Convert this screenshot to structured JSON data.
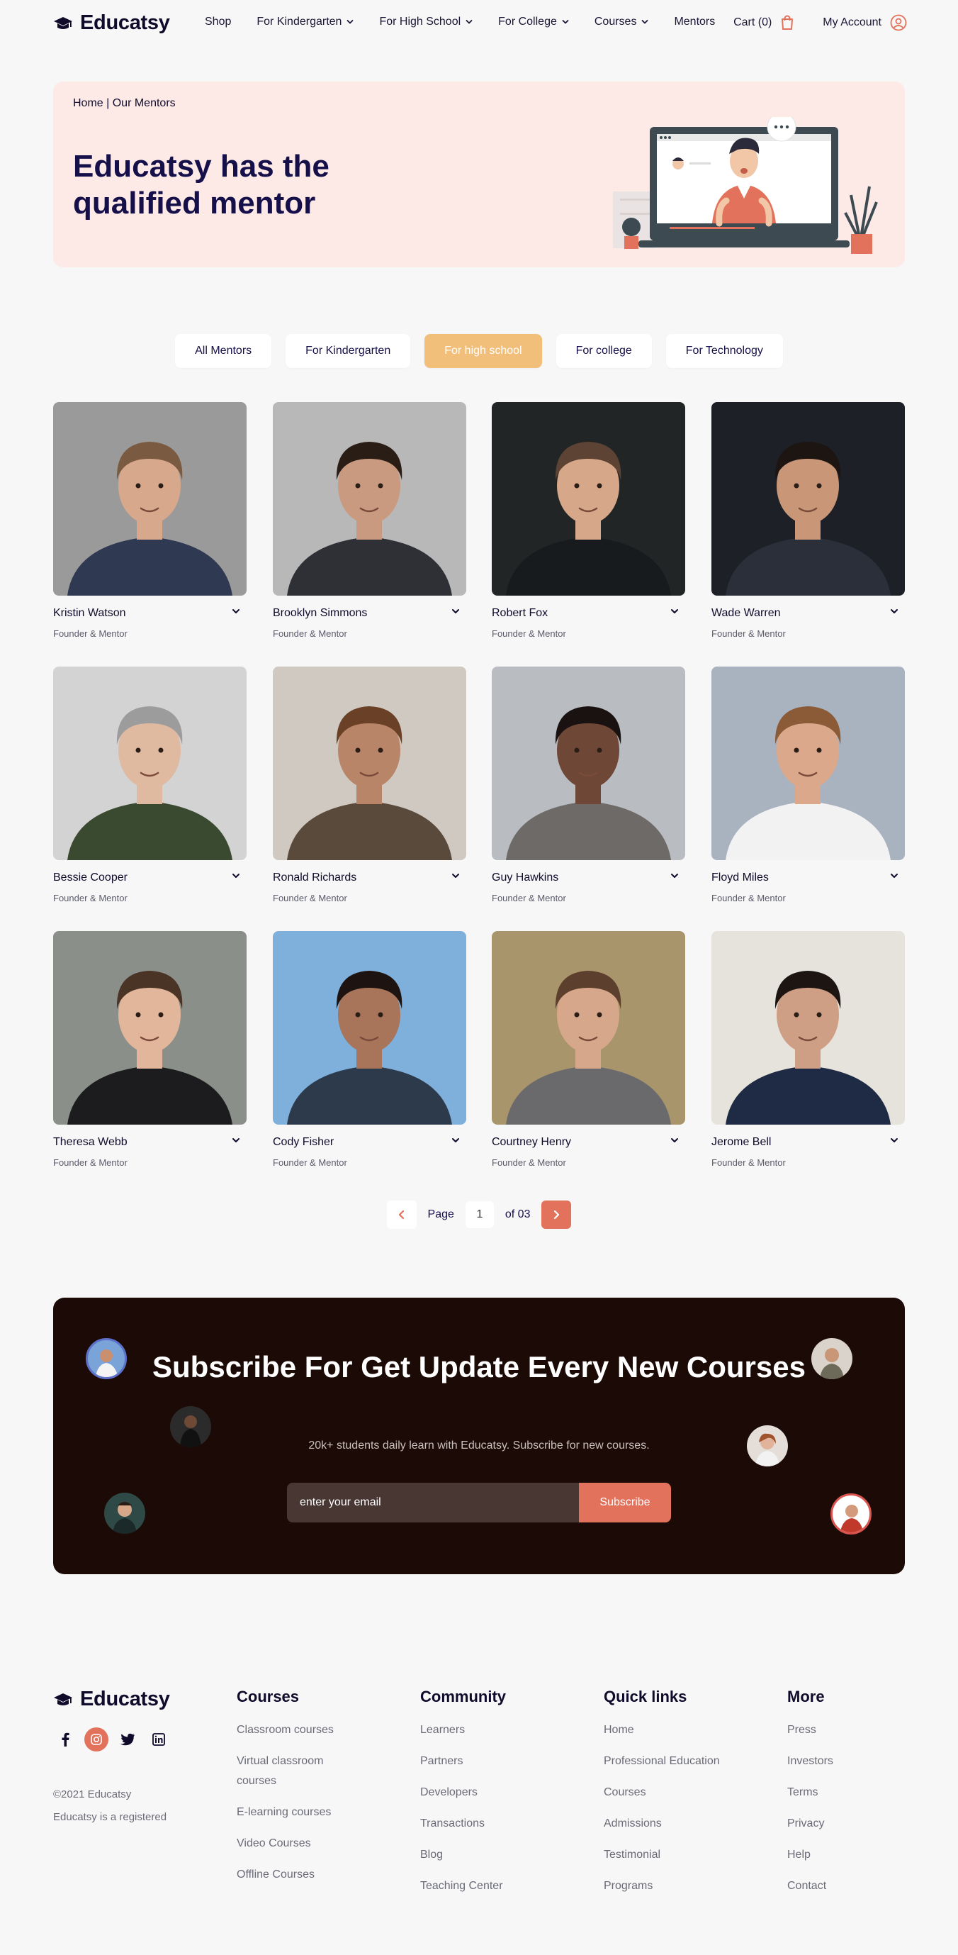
{
  "brand": {
    "name": "Educatsy"
  },
  "nav": {
    "items": [
      {
        "label": "Shop",
        "dropdown": false
      },
      {
        "label": "For Kindergarten",
        "dropdown": true
      },
      {
        "label": "For High School",
        "dropdown": true
      },
      {
        "label": "For College",
        "dropdown": true
      },
      {
        "label": "Courses",
        "dropdown": true
      },
      {
        "label": "Mentors",
        "dropdown": false
      }
    ],
    "cart_label": "Cart (0)",
    "account_label": "My Account"
  },
  "hero": {
    "breadcrumb": "Home | Our Mentors",
    "title": "Educatsy has the qualified mentor"
  },
  "filters": [
    {
      "label": "All Mentors",
      "active": false
    },
    {
      "label": "For Kindergarten",
      "active": false
    },
    {
      "label": "For high school",
      "active": true
    },
    {
      "label": "For college",
      "active": false
    },
    {
      "label": "For Technology",
      "active": false
    }
  ],
  "mentors": [
    {
      "name": "Kristin Watson",
      "role": "Founder & Mentor",
      "bg": "#9a9a9a",
      "shirt": "#2f3a52",
      "skin": "#d7a88c",
      "hair": "#7a5a40"
    },
    {
      "name": "Brooklyn Simmons",
      "role": "Founder & Mentor",
      "bg": "#b8b8b8",
      "shirt": "#2f3036",
      "skin": "#c99a80",
      "hair": "#2a1d16"
    },
    {
      "name": "Robert Fox",
      "role": "Founder & Mentor",
      "bg": "#222526",
      "shirt": "#181b1d",
      "skin": "#d6a889",
      "hair": "#5d4333"
    },
    {
      "name": "Wade Warren",
      "role": "Founder & Mentor",
      "bg": "#1d2027",
      "shirt": "#2b2f3a",
      "skin": "#c99778",
      "hair": "#1d1511"
    },
    {
      "name": "Bessie Cooper",
      "role": "Founder & Mentor",
      "bg": "#d3d3d3",
      "shirt": "#3a4a31",
      "skin": "#e0b9a1",
      "hair": "#9c9c9c"
    },
    {
      "name": "Ronald Richards",
      "role": "Founder & Mentor",
      "bg": "#cfc9c2",
      "shirt": "#5a4a3c",
      "skin": "#b98569",
      "hair": "#6a4126"
    },
    {
      "name": "Guy Hawkins",
      "role": "Founder & Mentor",
      "bg": "#b9bcc0",
      "shirt": "#6d6a68",
      "skin": "#6e4736",
      "hair": "#1a1210"
    },
    {
      "name": "Floyd Miles",
      "role": "Founder & Mentor",
      "bg": "#a8b3bf",
      "shirt": "#f2f2f2",
      "skin": "#dba88c",
      "hair": "#8b5a36"
    },
    {
      "name": "Theresa Webb",
      "role": "Founder & Mentor",
      "bg": "#8a8f8a",
      "shirt": "#1c1c1e",
      "skin": "#e2b69b",
      "hair": "#4a3426"
    },
    {
      "name": "Cody Fisher",
      "role": "Founder & Mentor",
      "bg": "#7fb0dc",
      "shirt": "#2c3a4c",
      "skin": "#a8755a",
      "hair": "#1d1411"
    },
    {
      "name": "Courtney Henry",
      "role": "Founder & Mentor",
      "bg": "#a9956c",
      "shirt": "#6a6a6c",
      "skin": "#d6a78a",
      "hair": "#5c3f2c"
    },
    {
      "name": "Jerome Bell",
      "role": "Founder & Mentor",
      "bg": "#e6e3dc",
      "shirt": "#1f2b44",
      "skin": "#cf9f85",
      "hair": "#1c1512"
    }
  ],
  "pagination": {
    "page_label": "Page",
    "current": "1",
    "of_label": "of 03"
  },
  "subscribe": {
    "title": "Subscribe For Get Update Every New Courses",
    "desc": "20k+ students daily learn with Educatsy. Subscribe for new courses.",
    "placeholder": "enter your email",
    "button": "Subscribe"
  },
  "footer": {
    "copyright": "©2021 Educatsy",
    "registered": "Educatsy is a registered",
    "columns": [
      {
        "title": "Courses",
        "links": [
          "Classroom courses",
          "Virtual classroom courses",
          "E-learning courses",
          "Video Courses",
          "Offline Courses"
        ]
      },
      {
        "title": "Community",
        "links": [
          "Learners",
          "Partners",
          "Developers",
          "Transactions",
          "Blog",
          "Teaching Center"
        ]
      },
      {
        "title": "Quick links",
        "links": [
          "Home",
          "Professional Education",
          "Courses",
          "Admissions",
          "Testimonial",
          "Programs"
        ]
      },
      {
        "title": "More",
        "links": [
          "Press",
          "Investors",
          "Terms",
          "Privacy",
          "Help",
          "Contact"
        ]
      }
    ]
  },
  "colors": {
    "accent": "#e2725b",
    "filter_active": "#f2bf7a",
    "hero_bg": "#fdeae6",
    "subscribe_bg": "#1b0a05",
    "heading": "#16104a"
  }
}
